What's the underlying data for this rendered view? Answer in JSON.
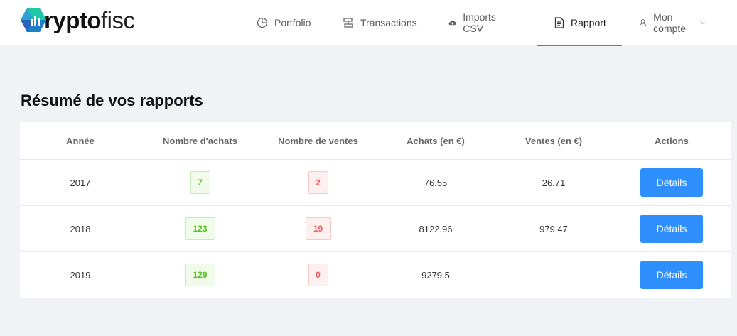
{
  "brand": {
    "name_bold": "ryptofisc_bold",
    "name_part1": "rypto",
    "name_part2": "fisc"
  },
  "nav": {
    "items": [
      {
        "label": "Portfolio",
        "icon": "pie-chart-icon"
      },
      {
        "label": "Transactions",
        "icon": "transactions-icon"
      },
      {
        "label": "Imports CSV",
        "icon": "cloud-upload-icon"
      },
      {
        "label": "Rapport",
        "icon": "file-text-icon",
        "active": true
      },
      {
        "label": "Mon compte",
        "icon": "user-icon"
      }
    ]
  },
  "page": {
    "title": "Résumé de vos rapports"
  },
  "table": {
    "columns": [
      "Année",
      "Nombre d'achats",
      "Nombre de ventes",
      "Achats (en €)",
      "Ventes (en €)",
      "Actions"
    ],
    "rows": [
      {
        "year": "2017",
        "buys": "7",
        "sells": "2",
        "buy_total": "76.55",
        "sell_total": "26.71",
        "action": "Détails"
      },
      {
        "year": "2018",
        "buys": "123",
        "sells": "19",
        "buy_total": "8122.96",
        "sell_total": "979.47",
        "action": "Détails"
      },
      {
        "year": "2019",
        "buys": "129",
        "sells": "0",
        "buy_total": "9279.5",
        "sell_total": "",
        "action": "Détails"
      }
    ]
  },
  "colors": {
    "accent": "#1890ff",
    "button": "#2f8fff",
    "green": "#52c41a",
    "red": "#f0595b"
  }
}
